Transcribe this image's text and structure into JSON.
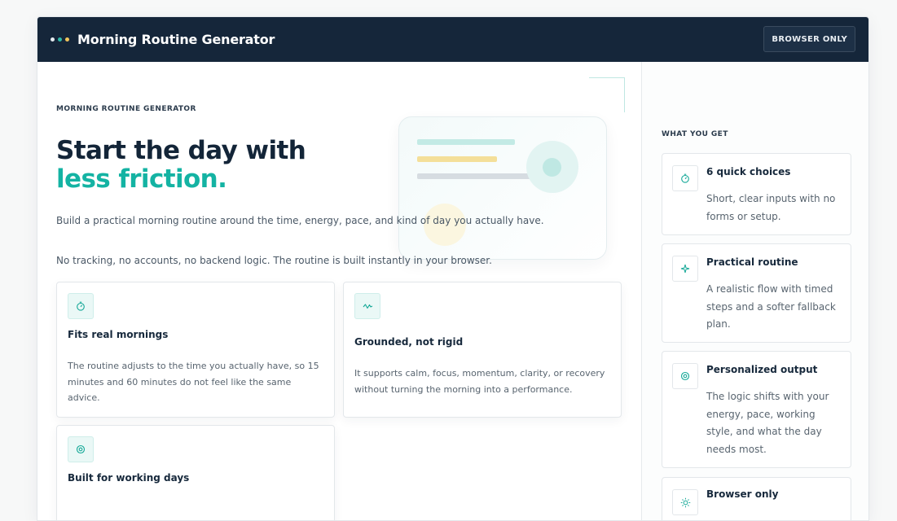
{
  "header": {
    "title": "Morning Routine Generator",
    "badge": "BROWSER ONLY",
    "dots": [
      "#e6ecf0",
      "#2fb9a9",
      "#f2c55c"
    ]
  },
  "hero": {
    "eyebrow": "MORNING ROUTINE GENERATOR",
    "headline_line1": "Start the day with",
    "headline_line2": "less friction.",
    "lead": "Build a practical morning routine around the time, energy, pace, and kind of day you actually have.",
    "note": "No tracking, no accounts, no backend logic. The routine is built instantly in your browser."
  },
  "features": [
    {
      "icon": "stopwatch-icon",
      "title": "Fits real mornings",
      "body": "The routine adjusts to the time you actually have, so 15 minutes and 60 minutes do not feel like the same advice."
    },
    {
      "icon": "wave-icon",
      "title": "Grounded, not rigid",
      "body": "It supports calm, focus, momentum, clarity, or recovery without turning the morning into a performance."
    },
    {
      "icon": "target-icon",
      "title": "Built for working days",
      "body": ""
    }
  ],
  "sidebar": {
    "label": "WHAT YOU GET",
    "items": [
      {
        "icon": "stopwatch-icon",
        "title": "6 quick choices",
        "body": "Short, clear inputs with no forms or setup."
      },
      {
        "icon": "sparkle-icon",
        "title": "Practical routine",
        "body": "A realistic flow with timed steps and a softer fallback plan."
      },
      {
        "icon": "target-icon",
        "title": "Personalized output",
        "body": "The logic shifts with your energy, pace, working style, and what the day needs most."
      },
      {
        "icon": "sun-icon",
        "title": "Browser only",
        "body": ""
      }
    ]
  },
  "colors": {
    "accent": "#14b3a3",
    "navy": "#15263a"
  }
}
